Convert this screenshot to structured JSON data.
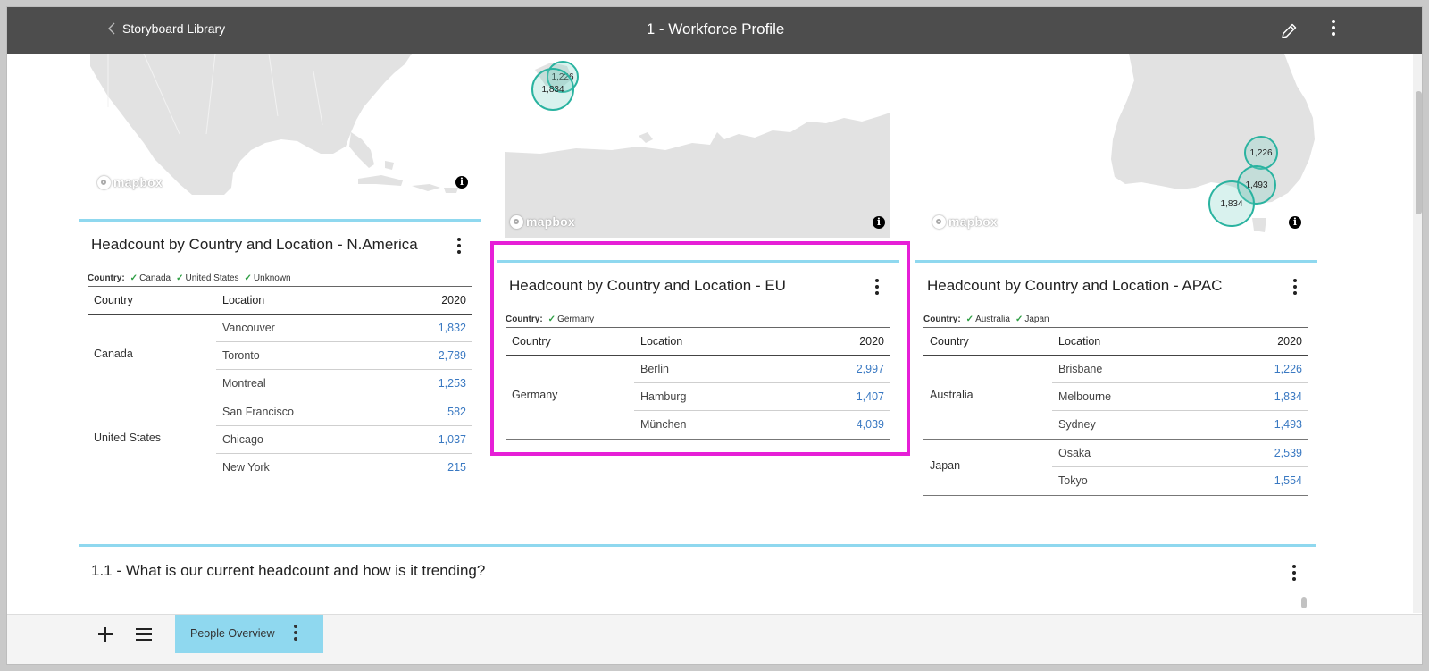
{
  "header": {
    "back_label": "Storyboard Library",
    "title": "1 - Workforce Profile"
  },
  "maps": {
    "attribution": "mapbox",
    "info_glyph": "i",
    "na": {},
    "eu": {
      "bubbles": [
        "1,226",
        "1,834"
      ]
    },
    "apac": {
      "bubbles": [
        "1,226",
        "1,493",
        "1,834"
      ]
    }
  },
  "cards": {
    "na": {
      "title": "Headcount by Country and Location - N.America",
      "filter_label": "Country:",
      "filters": [
        "Canada",
        "United States",
        "Unknown"
      ],
      "columns": [
        "Country",
        "Location",
        "2020"
      ],
      "groups": [
        {
          "country": "Canada",
          "rows": [
            {
              "location": "Vancouver",
              "value": "1,832"
            },
            {
              "location": "Toronto",
              "value": "2,789"
            },
            {
              "location": "Montreal",
              "value": "1,253"
            }
          ]
        },
        {
          "country": "United States",
          "rows": [
            {
              "location": "San Francisco",
              "value": "582"
            },
            {
              "location": "Chicago",
              "value": "1,037"
            },
            {
              "location": "New York",
              "value": "215"
            }
          ]
        }
      ]
    },
    "eu": {
      "title": "Headcount by Country and Location - EU",
      "filter_label": "Country:",
      "filters": [
        "Germany"
      ],
      "columns": [
        "Country",
        "Location",
        "2020"
      ],
      "groups": [
        {
          "country": "Germany",
          "rows": [
            {
              "location": "Berlin",
              "value": "2,997"
            },
            {
              "location": "Hamburg",
              "value": "1,407"
            },
            {
              "location": "München",
              "value": "4,039"
            }
          ]
        }
      ]
    },
    "apac": {
      "title": "Headcount by Country and Location - APAC",
      "filter_label": "Country:",
      "filters": [
        "Australia",
        "Japan"
      ],
      "columns": [
        "Country",
        "Location",
        "2020"
      ],
      "groups": [
        {
          "country": "Australia",
          "rows": [
            {
              "location": "Brisbane",
              "value": "1,226"
            },
            {
              "location": "Melbourne",
              "value": "1,834"
            },
            {
              "location": "Sydney",
              "value": "1,493"
            }
          ]
        },
        {
          "country": "Japan",
          "rows": [
            {
              "location": "Osaka",
              "value": "2,539"
            },
            {
              "location": "Tokyo",
              "value": "1,554"
            }
          ]
        }
      ]
    }
  },
  "section": {
    "title": "1.1 - What is our current headcount and how is it trending?"
  },
  "footer": {
    "tab_label": "People Overview"
  },
  "colors": {
    "accent": "#8fd8ef",
    "highlight": "#e61fd7",
    "value_link": "#3a79c2",
    "bubble": "#2ab3a0"
  }
}
